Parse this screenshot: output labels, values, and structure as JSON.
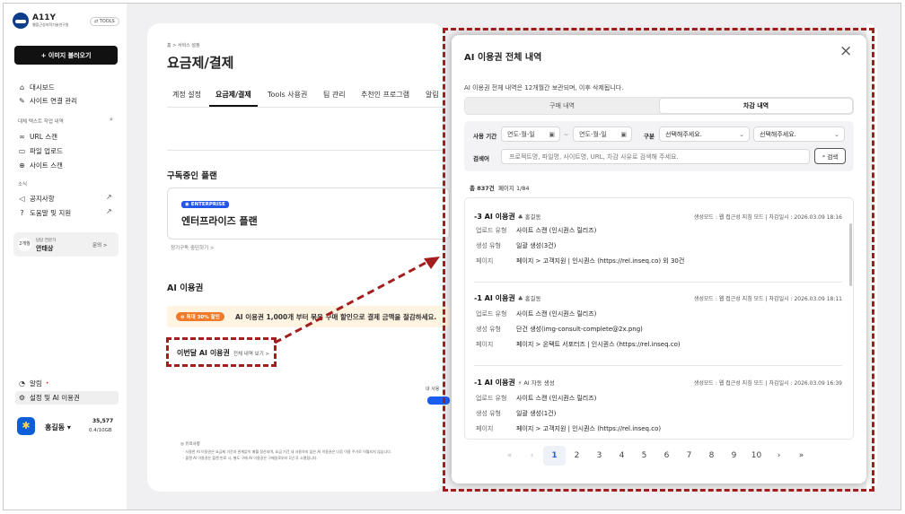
{
  "sidebar": {
    "logo_text": "A11Y",
    "logo_sub": "웹접근성과학기술연구원",
    "tools_badge": "TOOLS",
    "import_btn": "+ 이미지 불러오기",
    "nav": [
      "대시보드",
      "사이트 연결 관리"
    ],
    "section_history": "대체 텍스트 작업 내역",
    "history_items": [
      "URL 스캔",
      "파일 업로드",
      "사이트 스캔"
    ],
    "section_news": "소식",
    "news_items": [
      "공지사항",
      "도움말 및 지원"
    ],
    "promo": {
      "avatar": "2개월",
      "role": "담당 전문가",
      "name": "안태상",
      "action": "문의 >"
    },
    "bottom_items": [
      "알림",
      "설정 및 AI 이용권"
    ],
    "user": {
      "name": "홍길동",
      "credits": "35,577",
      "storage": "0.4/10GB"
    }
  },
  "main": {
    "breadcrumb": "홈 > 서비스 설정",
    "title": "요금제/결제",
    "tabs": [
      "계정 설정",
      "요금제/결제",
      "Tools 사용권",
      "팀 관리",
      "추천인 프로그램",
      "알림"
    ],
    "subscribed_heading": "구독중인 플랜",
    "plan_badge": "ENTERPRISE",
    "plan_name": "엔터프라이즈 플랜",
    "cancel_link": "정기구독 중단하기 >",
    "usage_heading": "AI 이용권",
    "discount_badge": "최대 30% 할인",
    "discount_text": "AI 이용권 1,000개 부터 묶음 구매 할인으로 결제 금액을 절감하세요.",
    "month_title": "이번달 AI 이용권",
    "month_link": "전체 내역 보기 >",
    "small_text": "내 사용",
    "notes_heading": "유의사항",
    "notes": [
      "· 사용한 AI 이용권은 요금제 기간과 관계없이 매월 정산되며, 요금 기간 내 사용하지 않은 AI 이용권은 다음 이용 주기로 이월되지 않습니다.",
      "· 플랜 AI 이용권은 플랜 만료 시, 별도 구매 AI 이용권은 구매일로부터 1년 후 소멸됩니다."
    ]
  },
  "modal": {
    "title": "AI 이용권 전체 내역",
    "close_icon": "×",
    "desc": "AI 이용권 전체 내역은 12개월간 보관되며, 이후 삭제됩니다.",
    "segments": [
      "구매 내역",
      "차감 내역"
    ],
    "active_segment": 1,
    "filter": {
      "period_label": "사용 기간",
      "date_from": "연도-월-일",
      "date_sep": "~",
      "date_to": "연도-월-일",
      "type_label": "구분",
      "select1": "선택해주세요.",
      "select2": "선택해주세요.",
      "search_label": "검색어",
      "search_placeholder": "프로젝트명, 파일명, 사이트명, URL, 차감 사유로 검색해 주세요.",
      "search_btn": "검색"
    },
    "summary_total": "총 837건",
    "summary_page": "페이지 1/84",
    "entries": [
      {
        "title": "-3 AI 이용권",
        "user": "♣ 홍길동",
        "mode": "생성모드 : 웹 접근성 지침 모드",
        "date": "차감일시 : 2026.03.09 18:16",
        "rows": [
          [
            "업로드 유형",
            "사이트 스캔 (인시퀀스 릴리즈)"
          ],
          [
            "생성 유형",
            "일괄 생성(3건)"
          ],
          [
            "페이지",
            "페이지 > 고객지원 | 인시퀀스 (https://rel.inseq.co) 외 30건"
          ]
        ]
      },
      {
        "title": "-1 AI 이용권",
        "user": "♣ 홍길동",
        "mode": "생성모드 : 웹 접근성 지침 모드",
        "date": "차감일시 : 2026.03.09 18:11",
        "rows": [
          [
            "업로드 유형",
            "사이트 스캔 (인시퀀스 릴리즈)"
          ],
          [
            "생성 유형",
            "단건 생성(img-consult-complete@2x.png)"
          ],
          [
            "페이지",
            "페이지 > 온택트 서포터즈 | 인시퀀스 (https://rel.inseq.co)"
          ]
        ]
      },
      {
        "title": "-1 AI 이용권",
        "user": "⚡ AI 자동 생성",
        "mode": "생성모드 : 웹 접근성 지침 모드",
        "date": "차감일시 : 2026.03.09 16:39",
        "rows": [
          [
            "업로드 유형",
            "사이트 스캔 (인시퀀스 릴리즈)"
          ],
          [
            "생성 유형",
            "일괄 생성(1건)"
          ],
          [
            "페이지",
            "페이지 > 고객지원 | 인시퀀스 (https://rel.inseq.co)"
          ]
        ]
      }
    ],
    "pagination": [
      "«",
      "‹",
      "1",
      "2",
      "3",
      "4",
      "5",
      "6",
      "7",
      "8",
      "9",
      "10",
      "›",
      "»"
    ],
    "current_page": "1"
  }
}
